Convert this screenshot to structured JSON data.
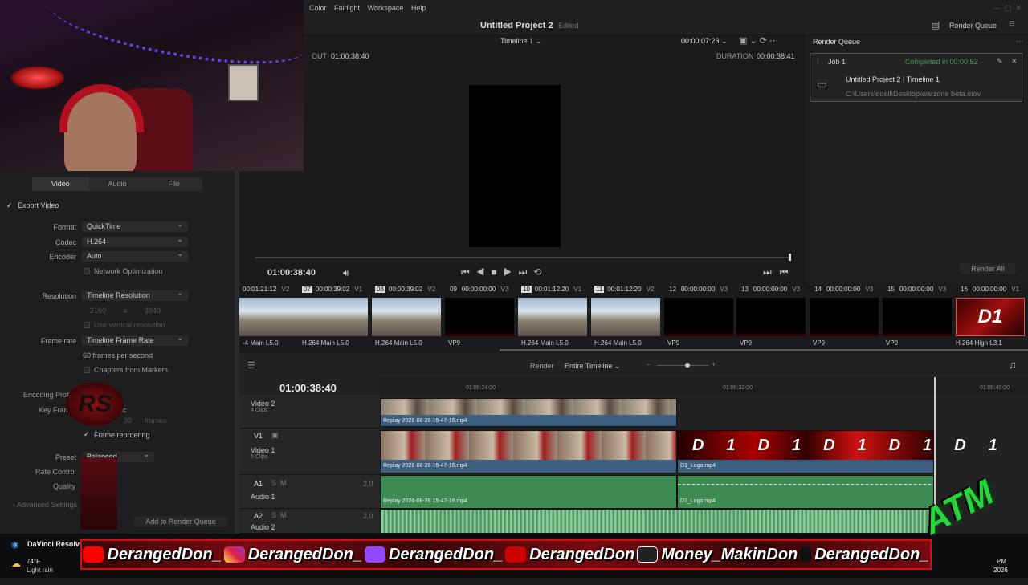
{
  "menu": [
    "Color",
    "Fairlight",
    "Workspace",
    "Help"
  ],
  "project": {
    "title": "Untitled Project 2",
    "status": "Edited"
  },
  "viewer": {
    "timeline": "Timeline 1",
    "timecode_top": "00:00:07:23",
    "out_label": "OUT",
    "out_tc": "01:00:38:40",
    "duration_label": "DURATION",
    "duration_tc": "00:00:38:41",
    "current_tc": "01:00:38:40"
  },
  "render_queue": {
    "title": "Render Queue",
    "header_btn": "Render Queue",
    "job_name": "Job 1",
    "job_status": "Completed in 00:00:52",
    "job_title": "Untitled Project 2 | Timeline 1",
    "job_path": "C:\\Users\\odall\\Desktop\\warzone beta.mov",
    "render_all": "Render All"
  },
  "settings": {
    "tabs": [
      "Video",
      "Audio",
      "File"
    ],
    "export_video": "Export Video",
    "format_label": "Format",
    "format": "QuickTime",
    "codec_label": "Codec",
    "codec": "H.264",
    "encoder_label": "Encoder",
    "encoder": "Auto",
    "network_opt": "Network Optimization",
    "resolution_label": "Resolution",
    "resolution": "Timeline Resolution",
    "res_w": "2160",
    "res_x": "x",
    "res_h": "3840",
    "vertical": "Use vertical resolution",
    "framerate_label": "Frame rate",
    "framerate": "Timeline Frame Rate",
    "fps_text": "60 frames per second",
    "chapters": "Chapters from Markers",
    "encoding_profile": "Encoding Profi",
    "keyframes": "Key Fram",
    "keyframes_suffix": "ic",
    "frames": "frames",
    "frames_value": "30",
    "frame_reorder": "Frame reordering",
    "preset_label": "Preset",
    "preset": "Balanced",
    "rate_label": "Rate Control",
    "quality_label": "Quality",
    "advanced": "Advanced Settings",
    "add_queue": "Add to Render Queue"
  },
  "clips": [
    {
      "num": "",
      "tc": "00:01:21:12",
      "track": "V2",
      "codec": "-4 Main L5.0"
    },
    {
      "num": "07",
      "tc": "00:00:39:02",
      "track": "V1",
      "codec": "H.264 Main L5.0"
    },
    {
      "num": "08",
      "tc": "00:00:39:02",
      "track": "V2",
      "codec": "H.264 Main L5.0"
    },
    {
      "num": "09",
      "tc": "00:00:00:00",
      "track": "V3",
      "codec": "VP9"
    },
    {
      "num": "10",
      "tc": "00:01:12:20",
      "track": "V1",
      "codec": "H.264 Main L5.0"
    },
    {
      "num": "11",
      "tc": "00:01:12:20",
      "track": "V2",
      "codec": "H.264 Main L5.0"
    },
    {
      "num": "12",
      "tc": "00:00:00:00",
      "track": "V3",
      "codec": "VP9"
    },
    {
      "num": "13",
      "tc": "00:00:00:00",
      "track": "V3",
      "codec": "VP9"
    },
    {
      "num": "14",
      "tc": "00:00:00:00",
      "track": "V3",
      "codec": "VP9"
    },
    {
      "num": "15",
      "tc": "00:00:00:00",
      "track": "V3",
      "codec": "VP9"
    },
    {
      "num": "16",
      "tc": "00:00:00:00",
      "track": "V1",
      "codec": "H.264 High L3.1"
    }
  ],
  "timeline": {
    "render_label": "Render",
    "render_sel": "Entire Timeline",
    "tc": "01:00:38:40",
    "ruler": [
      "01:00:24:00",
      "01:00:32:00",
      "01:00:40:00"
    ],
    "video2": {
      "name": "Video 2",
      "count": "4 Clips",
      "clip": "Replay 2026-08-28 15-47-16.mp4"
    },
    "video1": {
      "id": "V1",
      "name": "Video 1",
      "count": "5 Clips",
      "clip": "Replay 2026-08-28 15-47-16.mp4",
      "clip2": "D1_Logo.mp4"
    },
    "audio1": {
      "id": "A1",
      "name": "Audio 1",
      "level": "2.0",
      "clip": "Replay 2026-08-28 15-47-16.mp4",
      "clip2": "D1_Logo.mp4"
    },
    "audio2": {
      "id": "A2",
      "name": "Audio 2",
      "level": "2.0"
    }
  },
  "taskbar": {
    "app": "DaVinci Resolve",
    "temp": "74°F",
    "weather": "Light rain",
    "clock1": "PM",
    "clock2": "2026"
  },
  "overlay": {
    "socials": [
      "DerangedDon_",
      "DerangedDon_",
      "DerangedDon_",
      "DerangedDon",
      "Money_MakinDon",
      "DerangedDon_"
    ],
    "atm": "ATM",
    "logo": "D1"
  },
  "colors": {
    "accent": "#e0504a",
    "clip_video": "#3b5f7d",
    "clip_audio": "#3e8a52",
    "completed": "#3aa24a"
  }
}
